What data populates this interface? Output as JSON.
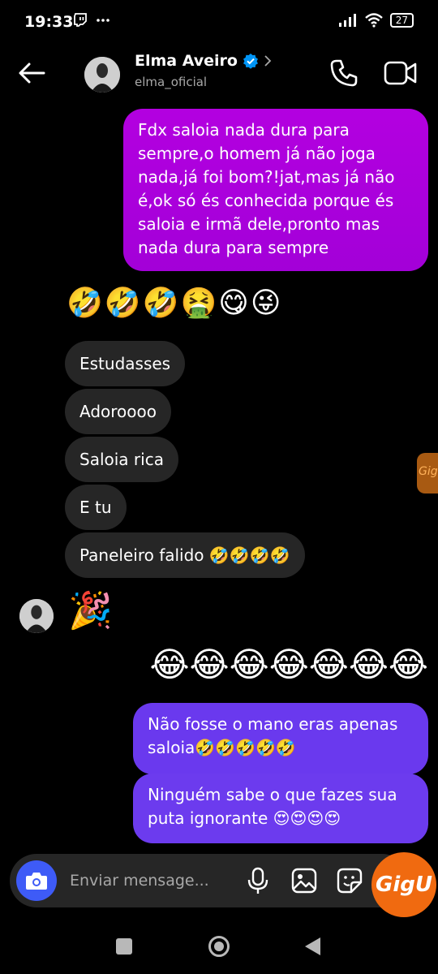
{
  "status_bar": {
    "time": "19:33",
    "battery": "27"
  },
  "header": {
    "name": "Elma Aveiro",
    "username": "elma_oficial"
  },
  "messages": {
    "out_1": "Fdx saloia nada dura para sempre,o homem já não joga nada,já foi bom?!jat,mas já não é,ok só és conhecida porque és saloia e irmã dele,pronto mas nada dura para sempre",
    "emoji_row_1": "🤣🤣🤣🤮😋😜",
    "in_1": "Estudasses",
    "in_2": "Adoroooo",
    "in_3": "Saloia rica",
    "in_4": "E tu",
    "in_5": "Paneleiro falido 🤣🤣🤣🤣",
    "party_emoji": "🎉",
    "emoji_row_2": "😂😂😂😂😂😂😂",
    "out_2": "Não fosse o mano eras apenas saloia🤣🤣🤣🤣🤣",
    "out_3": "Ninguém sabe o que fazes sua puta ignorante 😍😍😍😍"
  },
  "side_tab": {
    "label": "Gigu"
  },
  "composer": {
    "placeholder": "Enviar mensage..."
  },
  "gigu_button": {
    "label": "GigU"
  },
  "colors": {
    "outgoing_magenta": "#b300e0",
    "outgoing_purple": "#6a39ee",
    "incoming": "#262626",
    "camera_blue": "#3e5bf7",
    "gigu_orange": "#f06a10",
    "verified_blue": "#0095f6"
  },
  "icons": [
    "back-arrow-icon",
    "verified-badge-icon",
    "chevron-right-icon",
    "phone-icon",
    "video-camera-icon",
    "camera-icon",
    "microphone-icon",
    "gallery-icon",
    "sticker-icon"
  ]
}
